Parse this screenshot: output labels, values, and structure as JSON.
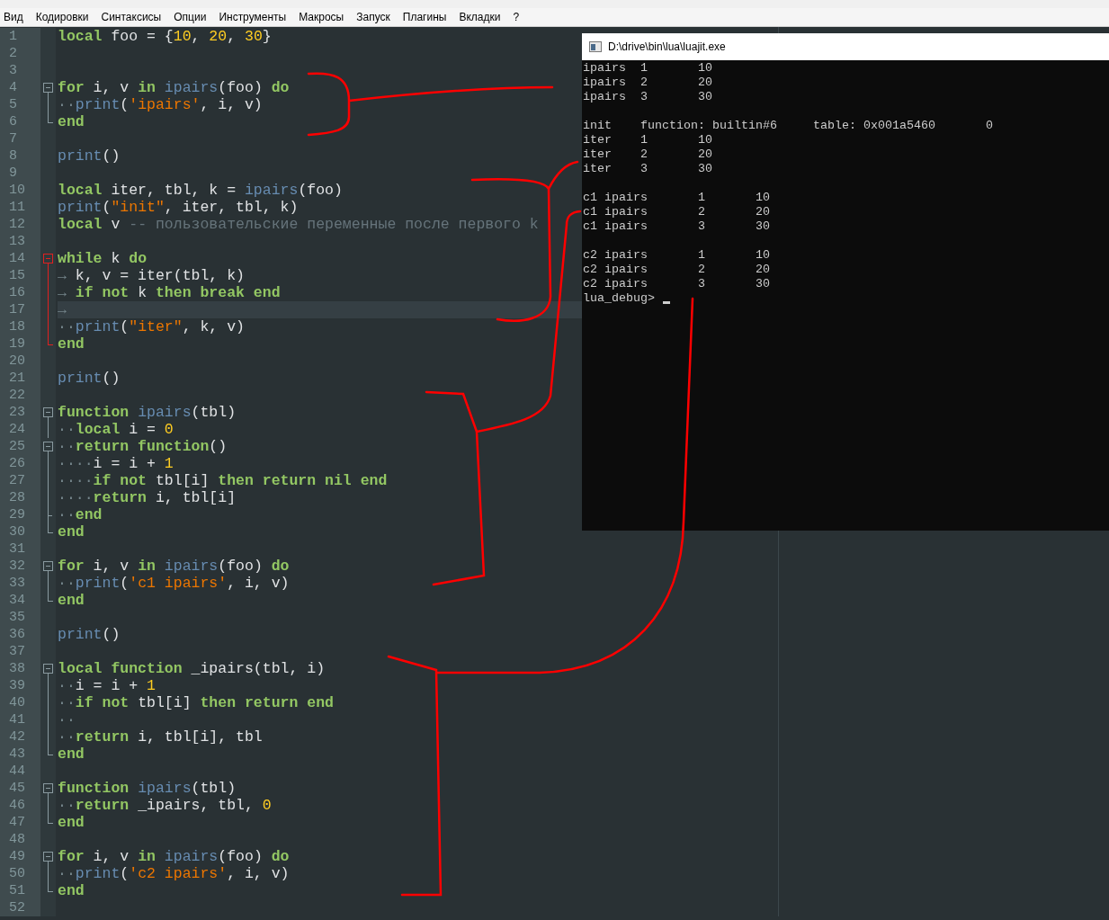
{
  "menu": [
    "Вид",
    "Кодировки",
    "Синтаксисы",
    "Опции",
    "Инструменты",
    "Макросы",
    "Запуск",
    "Плагины",
    "Вкладки",
    "?"
  ],
  "editor": {
    "lines": [
      {
        "number": "1",
        "tokens": [
          {
            "kind": "keyword",
            "text": "local"
          },
          {
            "kind": "plain",
            "text": " foo = {"
          },
          {
            "kind": "number",
            "text": "10"
          },
          {
            "kind": "plain",
            "text": ", "
          },
          {
            "kind": "number",
            "text": "20"
          },
          {
            "kind": "plain",
            "text": ", "
          },
          {
            "kind": "number",
            "text": "30"
          },
          {
            "kind": "plain",
            "text": "}"
          }
        ]
      },
      {
        "number": "2"
      },
      {
        "number": "3"
      },
      {
        "number": "4",
        "fold": {
          "kind": "start",
          "active": false
        },
        "tokens": [
          {
            "kind": "keyword",
            "text": "for"
          },
          {
            "kind": "plain",
            "text": " i, v "
          },
          {
            "kind": "keyword",
            "text": "in "
          },
          {
            "kind": "builtin",
            "text": "ipairs"
          },
          {
            "kind": "plain",
            "text": "(foo) "
          },
          {
            "kind": "keyword",
            "text": "do"
          }
        ]
      },
      {
        "number": "5",
        "fold": {
          "kind": "line",
          "active": false
        },
        "tokens": [
          {
            "kind": "whitespace",
            "text": "··"
          },
          {
            "kind": "builtin",
            "text": "print"
          },
          {
            "kind": "plain",
            "text": "("
          },
          {
            "kind": "string",
            "text": "'ipairs'"
          },
          {
            "kind": "plain",
            "text": ", i, v)"
          }
        ]
      },
      {
        "number": "6",
        "fold": {
          "kind": "end",
          "active": false
        },
        "tokens": [
          {
            "kind": "keyword",
            "text": "end"
          }
        ]
      },
      {
        "number": "7"
      },
      {
        "number": "8",
        "tokens": [
          {
            "kind": "builtin",
            "text": "print"
          },
          {
            "kind": "plain",
            "text": "()"
          }
        ]
      },
      {
        "number": "9"
      },
      {
        "number": "10",
        "tokens": [
          {
            "kind": "keyword",
            "text": "local"
          },
          {
            "kind": "plain",
            "text": " iter, tbl, k = "
          },
          {
            "kind": "builtin",
            "text": "ipairs"
          },
          {
            "kind": "plain",
            "text": "(foo)"
          }
        ]
      },
      {
        "number": "11",
        "tokens": [
          {
            "kind": "builtin",
            "text": "print"
          },
          {
            "kind": "plain",
            "text": "("
          },
          {
            "kind": "string",
            "text": "\"init\""
          },
          {
            "kind": "plain",
            "text": ", iter, tbl, k)"
          }
        ]
      },
      {
        "number": "12",
        "tokens": [
          {
            "kind": "keyword",
            "text": "local"
          },
          {
            "kind": "plain",
            "text": " v "
          },
          {
            "kind": "comment",
            "text": "-- пользовательские переменные после первого k"
          }
        ]
      },
      {
        "number": "13"
      },
      {
        "number": "14",
        "fold": {
          "kind": "start",
          "active": true
        },
        "tokens": [
          {
            "kind": "keyword",
            "text": "while"
          },
          {
            "kind": "plain",
            "text": " k "
          },
          {
            "kind": "keyword",
            "text": "do"
          }
        ]
      },
      {
        "number": "15",
        "fold": {
          "kind": "line",
          "active": true
        },
        "tokens": [
          {
            "kind": "whitespace",
            "text": "→"
          },
          {
            "kind": "plain",
            "text": " k, v = iter(tbl, k)"
          }
        ]
      },
      {
        "number": "16",
        "fold": {
          "kind": "line",
          "active": true
        },
        "tokens": [
          {
            "kind": "whitespace",
            "text": "→ "
          },
          {
            "kind": "keyword",
            "text": "if not"
          },
          {
            "kind": "plain",
            "text": " k "
          },
          {
            "kind": "keyword",
            "text": "then break end"
          }
        ]
      },
      {
        "number": "17",
        "current": true,
        "fold": {
          "kind": "line",
          "active": true
        },
        "tokens": [
          {
            "kind": "whitespace",
            "text": "→"
          }
        ]
      },
      {
        "number": "18",
        "fold": {
          "kind": "line",
          "active": true
        },
        "tokens": [
          {
            "kind": "whitespace",
            "text": "··"
          },
          {
            "kind": "builtin",
            "text": "print"
          },
          {
            "kind": "plain",
            "text": "("
          },
          {
            "kind": "string",
            "text": "\"iter\""
          },
          {
            "kind": "plain",
            "text": ", k, v)"
          }
        ]
      },
      {
        "number": "19",
        "fold": {
          "kind": "end",
          "active": true
        },
        "tokens": [
          {
            "kind": "keyword",
            "text": "end"
          }
        ]
      },
      {
        "number": "20"
      },
      {
        "number": "21",
        "tokens": [
          {
            "kind": "builtin",
            "text": "print"
          },
          {
            "kind": "plain",
            "text": "()"
          }
        ]
      },
      {
        "number": "22"
      },
      {
        "number": "23",
        "fold": {
          "kind": "start",
          "active": false
        },
        "tokens": [
          {
            "kind": "keyword",
            "text": "function "
          },
          {
            "kind": "builtin",
            "text": "ipairs"
          },
          {
            "kind": "plain",
            "text": "(tbl)"
          }
        ]
      },
      {
        "number": "24",
        "fold": {
          "kind": "line",
          "active": false
        },
        "tokens": [
          {
            "kind": "whitespace",
            "text": "··"
          },
          {
            "kind": "keyword",
            "text": "local"
          },
          {
            "kind": "plain",
            "text": " i = "
          },
          {
            "kind": "number",
            "text": "0"
          }
        ]
      },
      {
        "number": "25",
        "fold": {
          "kind": "start",
          "active": false
        },
        "tokens": [
          {
            "kind": "whitespace",
            "text": "··"
          },
          {
            "kind": "keyword",
            "text": "return function"
          },
          {
            "kind": "plain",
            "text": "()"
          }
        ]
      },
      {
        "number": "26",
        "fold": {
          "kind": "line",
          "active": false
        },
        "tokens": [
          {
            "kind": "whitespace",
            "text": "····"
          },
          {
            "kind": "plain",
            "text": "i = i + "
          },
          {
            "kind": "number",
            "text": "1"
          }
        ]
      },
      {
        "number": "27",
        "fold": {
          "kind": "line",
          "active": false
        },
        "tokens": [
          {
            "kind": "whitespace",
            "text": "····"
          },
          {
            "kind": "keyword",
            "text": "if not"
          },
          {
            "kind": "plain",
            "text": " tbl[i] "
          },
          {
            "kind": "keyword",
            "text": "then return nil end"
          }
        ]
      },
      {
        "number": "28",
        "fold": {
          "kind": "line",
          "active": false
        },
        "tokens": [
          {
            "kind": "whitespace",
            "text": "····"
          },
          {
            "kind": "keyword",
            "text": "return"
          },
          {
            "kind": "plain",
            "text": " i, tbl[i]"
          }
        ]
      },
      {
        "number": "29",
        "fold": {
          "kind": "mid",
          "active": false
        },
        "tokens": [
          {
            "kind": "whitespace",
            "text": "··"
          },
          {
            "kind": "keyword",
            "text": "end"
          }
        ]
      },
      {
        "number": "30",
        "fold": {
          "kind": "end",
          "active": false
        },
        "tokens": [
          {
            "kind": "keyword",
            "text": "end"
          }
        ]
      },
      {
        "number": "31"
      },
      {
        "number": "32",
        "fold": {
          "kind": "start",
          "active": false
        },
        "tokens": [
          {
            "kind": "keyword",
            "text": "for"
          },
          {
            "kind": "plain",
            "text": " i, v "
          },
          {
            "kind": "keyword",
            "text": "in "
          },
          {
            "kind": "builtin",
            "text": "ipairs"
          },
          {
            "kind": "plain",
            "text": "(foo) "
          },
          {
            "kind": "keyword",
            "text": "do"
          }
        ]
      },
      {
        "number": "33",
        "fold": {
          "kind": "line",
          "active": false
        },
        "tokens": [
          {
            "kind": "whitespace",
            "text": "··"
          },
          {
            "kind": "builtin",
            "text": "print"
          },
          {
            "kind": "plain",
            "text": "("
          },
          {
            "kind": "string",
            "text": "'c1 ipairs'"
          },
          {
            "kind": "plain",
            "text": ", i, v)"
          }
        ]
      },
      {
        "number": "34",
        "fold": {
          "kind": "end",
          "active": false
        },
        "tokens": [
          {
            "kind": "keyword",
            "text": "end"
          }
        ]
      },
      {
        "number": "35"
      },
      {
        "number": "36",
        "tokens": [
          {
            "kind": "builtin",
            "text": "print"
          },
          {
            "kind": "plain",
            "text": "()"
          }
        ]
      },
      {
        "number": "37"
      },
      {
        "number": "38",
        "fold": {
          "kind": "start",
          "active": false
        },
        "tokens": [
          {
            "kind": "keyword",
            "text": "local function"
          },
          {
            "kind": "plain",
            "text": " _ipairs(tbl, i)"
          }
        ]
      },
      {
        "number": "39",
        "fold": {
          "kind": "line",
          "active": false
        },
        "tokens": [
          {
            "kind": "whitespace",
            "text": "··"
          },
          {
            "kind": "plain",
            "text": "i = i + "
          },
          {
            "kind": "number",
            "text": "1"
          }
        ]
      },
      {
        "number": "40",
        "fold": {
          "kind": "line",
          "active": false
        },
        "tokens": [
          {
            "kind": "whitespace",
            "text": "··"
          },
          {
            "kind": "keyword",
            "text": "if not"
          },
          {
            "kind": "plain",
            "text": " tbl[i] "
          },
          {
            "kind": "keyword",
            "text": "then return end"
          }
        ]
      },
      {
        "number": "41",
        "fold": {
          "kind": "line",
          "active": false
        },
        "tokens": [
          {
            "kind": "whitespace",
            "text": "··"
          }
        ]
      },
      {
        "number": "42",
        "fold": {
          "kind": "line",
          "active": false
        },
        "tokens": [
          {
            "kind": "whitespace",
            "text": "··"
          },
          {
            "kind": "keyword",
            "text": "return"
          },
          {
            "kind": "plain",
            "text": " i, tbl[i], tbl"
          }
        ]
      },
      {
        "number": "43",
        "fold": {
          "kind": "end",
          "active": false
        },
        "tokens": [
          {
            "kind": "keyword",
            "text": "end"
          }
        ]
      },
      {
        "number": "44"
      },
      {
        "number": "45",
        "fold": {
          "kind": "start",
          "active": false
        },
        "tokens": [
          {
            "kind": "keyword",
            "text": "function "
          },
          {
            "kind": "builtin",
            "text": "ipairs"
          },
          {
            "kind": "plain",
            "text": "(tbl)"
          }
        ]
      },
      {
        "number": "46",
        "fold": {
          "kind": "line",
          "active": false
        },
        "tokens": [
          {
            "kind": "whitespace",
            "text": "··"
          },
          {
            "kind": "keyword",
            "text": "return"
          },
          {
            "kind": "plain",
            "text": " _ipairs, tbl, "
          },
          {
            "kind": "number",
            "text": "0"
          }
        ]
      },
      {
        "number": "47",
        "fold": {
          "kind": "end",
          "active": false
        },
        "tokens": [
          {
            "kind": "keyword",
            "text": "end"
          }
        ]
      },
      {
        "number": "48"
      },
      {
        "number": "49",
        "fold": {
          "kind": "start",
          "active": false
        },
        "tokens": [
          {
            "kind": "keyword",
            "text": "for"
          },
          {
            "kind": "plain",
            "text": " i, v "
          },
          {
            "kind": "keyword",
            "text": "in "
          },
          {
            "kind": "builtin",
            "text": "ipairs"
          },
          {
            "kind": "plain",
            "text": "(foo) "
          },
          {
            "kind": "keyword",
            "text": "do"
          }
        ]
      },
      {
        "number": "50",
        "fold": {
          "kind": "line",
          "active": false
        },
        "tokens": [
          {
            "kind": "whitespace",
            "text": "··"
          },
          {
            "kind": "builtin",
            "text": "print"
          },
          {
            "kind": "plain",
            "text": "("
          },
          {
            "kind": "string",
            "text": "'c2 ipairs'"
          },
          {
            "kind": "plain",
            "text": ", i, v)"
          }
        ]
      },
      {
        "number": "51",
        "fold": {
          "kind": "end",
          "active": false
        },
        "tokens": [
          {
            "kind": "keyword",
            "text": "end"
          }
        ]
      },
      {
        "number": "52"
      }
    ]
  },
  "console": {
    "title": "D:\\drive\\bin\\lua\\luajit.exe",
    "blocks": [
      [
        [
          "ipairs",
          "1",
          "10"
        ],
        [
          "ipairs",
          "2",
          "20"
        ],
        [
          "ipairs",
          "3",
          "30"
        ]
      ],
      [
        [
          "init",
          "function: builtin#6",
          "table: 0x001a5460",
          "0"
        ],
        [
          "iter",
          "1",
          "10"
        ],
        [
          "iter",
          "2",
          "20"
        ],
        [
          "iter",
          "3",
          "30"
        ]
      ],
      [
        [
          "c1 ipairs",
          "1",
          "10"
        ],
        [
          "c1 ipairs",
          "2",
          "20"
        ],
        [
          "c1 ipairs",
          "3",
          "30"
        ]
      ],
      [
        [
          "c2 ipairs",
          "1",
          "10"
        ],
        [
          "c2 ipairs",
          "2",
          "20"
        ],
        [
          "c2 ipairs",
          "3",
          "30"
        ]
      ]
    ],
    "prompt": "lua_debug>"
  }
}
